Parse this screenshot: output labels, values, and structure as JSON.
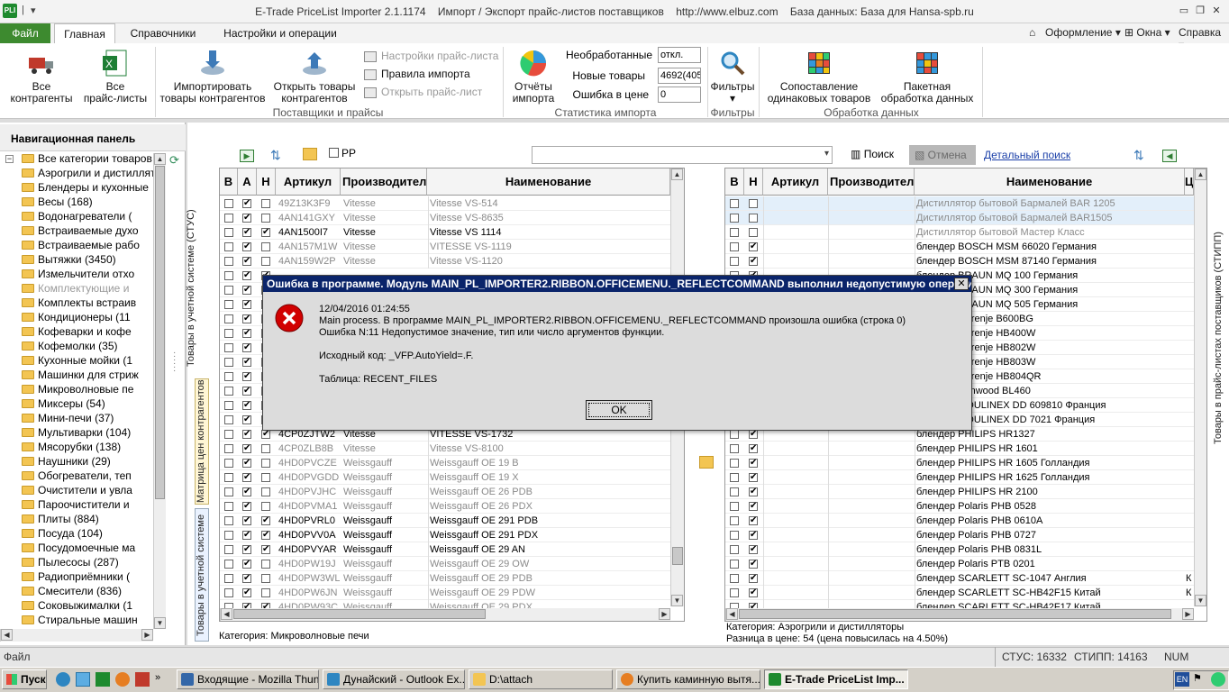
{
  "window": {
    "title": "E-Trade PriceList Importer 2.1.1174    Импорт / Экспорт прайс-листов поставщиков    http://www.elbuz.com    База данных: База для Hansa-spb.ru",
    "app_icon": "PLI"
  },
  "menu": {
    "file": "Файл",
    "tabs": [
      "Главная",
      "Справочники",
      "Настройки и операции"
    ],
    "right": [
      "Оформление",
      "Окна",
      "Справка"
    ]
  },
  "ribbon": {
    "contractors": "Все\nконтрагенты",
    "pricelists": "Все\nпрайс-листы",
    "import_goods": "Импортировать\nтовары контрагентов",
    "open_goods": "Открыть товары\nконтрагентов",
    "pricelist_settings": "Настройки прайс-листа",
    "import_rules": "Правила импорта",
    "open_pricelist": "Открыть прайс-лист",
    "group_suppliers": "Поставщики и прайсы",
    "import_reports": "Отчёты\nимпорта",
    "stat_unprocessed_label": "Необработанные",
    "stat_unprocessed_value": "откл.",
    "stat_new_label": "Новые товары",
    "stat_new_value": "4692(405",
    "stat_error_label": "Ошибка в цене",
    "stat_error_value": "0",
    "group_stats": "Статистика импорта",
    "filters": "Фильтры",
    "group_filters": "Фильтры",
    "match_goods": "Сопоставление\nодинаковых товаров",
    "batch_processing": "Пакетная\nобработка данных",
    "group_data": "Обработка данных"
  },
  "nav": {
    "title": "Навигационная панель",
    "root": "Все категории товаров",
    "items": [
      {
        "label": "Аэрогрили и дистиллят",
        "disabled": false
      },
      {
        "label": "Блендеры и кухонные",
        "disabled": false
      },
      {
        "label": "Весы (168)",
        "disabled": false
      },
      {
        "label": "Водонагреватели (",
        "disabled": false
      },
      {
        "label": "Встраиваемые духо",
        "disabled": false
      },
      {
        "label": "Встраиваемые рабо",
        "disabled": false
      },
      {
        "label": "Вытяжки (3450)",
        "disabled": false
      },
      {
        "label": "Измельчители отхо",
        "disabled": false
      },
      {
        "label": "Комплектующие и",
        "disabled": true
      },
      {
        "label": "Комплекты встраив",
        "disabled": false
      },
      {
        "label": "Кондиционеры (11",
        "disabled": false
      },
      {
        "label": "Кофеварки и кофе",
        "disabled": false
      },
      {
        "label": "Кофемолки (35)",
        "disabled": false
      },
      {
        "label": "Кухонные мойки (1",
        "disabled": false
      },
      {
        "label": "Машинки для стриж",
        "disabled": false
      },
      {
        "label": "Микроволновые пе",
        "disabled": false
      },
      {
        "label": "Миксеры (54)",
        "disabled": false
      },
      {
        "label": "Мини-печи (37)",
        "disabled": false
      },
      {
        "label": "Мультиварки (104)",
        "disabled": false
      },
      {
        "label": "Мясорубки (138)",
        "disabled": false
      },
      {
        "label": "Наушники (29)",
        "disabled": false
      },
      {
        "label": "Обогреватели, теп",
        "disabled": false
      },
      {
        "label": "Очистители и увла",
        "disabled": false
      },
      {
        "label": "Пароочистители и",
        "disabled": false
      },
      {
        "label": "Плиты (884)",
        "disabled": false
      },
      {
        "label": "Посуда (104)",
        "disabled": false
      },
      {
        "label": "Посудомоечные ма",
        "disabled": false
      },
      {
        "label": "Пылесосы (287)",
        "disabled": false
      },
      {
        "label": "Радиоприёмники (",
        "disabled": false
      },
      {
        "label": "Смесители (836)",
        "disabled": false
      },
      {
        "label": "Соковыжималки (1",
        "disabled": false
      },
      {
        "label": "Стиральные машин",
        "disabled": false
      }
    ]
  },
  "left_panel": {
    "side_tab_top": "Товары в учетной системе (СТУС)",
    "side_tab_matrix": "Матрица цен контрагентов",
    "side_tab_bottom": "Товары в учетной системе",
    "pp_label": "PP",
    "headers": [
      "В",
      "А",
      "Н",
      "Артикул",
      "Производитель",
      "Наименование"
    ],
    "rows": [
      {
        "a": true,
        "n": false,
        "art": "49Z13K3F9",
        "mfr": "Vitesse",
        "name": "Vitesse VS-514",
        "gray": true
      },
      {
        "a": true,
        "n": false,
        "art": "4AN141GXY",
        "mfr": "Vitesse",
        "name": "Vitesse VS-8635",
        "gray": true
      },
      {
        "a": true,
        "n": true,
        "art": "4AN1500I7",
        "mfr": "Vitesse",
        "name": "Vitesse VS 1114",
        "gray": false
      },
      {
        "a": true,
        "n": false,
        "art": "4AN157M1W",
        "mfr": "Vitesse",
        "name": "VITESSE VS-1119",
        "gray": true
      },
      {
        "a": true,
        "n": false,
        "art": "4AN159W2P",
        "mfr": "Vitesse",
        "name": "Vitesse VS-1120",
        "gray": true
      },
      {
        "a": true,
        "n": true,
        "art": "",
        "mfr": "",
        "name": "",
        "gray": false
      },
      {
        "a": true,
        "n": true,
        "art": "",
        "mfr": "",
        "name": "",
        "gray": false
      },
      {
        "a": true,
        "n": true,
        "art": "",
        "mfr": "",
        "name": "",
        "gray": false
      },
      {
        "a": true,
        "n": true,
        "art": "",
        "mfr": "",
        "name": "",
        "gray": false
      },
      {
        "a": true,
        "n": true,
        "art": "",
        "mfr": "",
        "name": "",
        "gray": false
      },
      {
        "a": true,
        "n": true,
        "art": "",
        "mfr": "",
        "name": "",
        "gray": false
      },
      {
        "a": true,
        "n": true,
        "art": "",
        "mfr": "",
        "name": "",
        "gray": false
      },
      {
        "a": true,
        "n": true,
        "art": "",
        "mfr": "",
        "name": "",
        "gray": false
      },
      {
        "a": true,
        "n": true,
        "art": "",
        "mfr": "",
        "name": "",
        "gray": false
      },
      {
        "a": true,
        "n": true,
        "art": "",
        "mfr": "",
        "name": "",
        "gray": false
      },
      {
        "a": true,
        "n": true,
        "art": "",
        "mfr": "",
        "name": "",
        "gray": false
      },
      {
        "a": true,
        "n": true,
        "art": "4CP0ZJTW2",
        "mfr": "Vitesse",
        "name": "VITESSE VS-1732",
        "gray": false
      },
      {
        "a": true,
        "n": false,
        "art": "4CP0ZLB8B",
        "mfr": "Vitesse",
        "name": "Vitesse VS-8100",
        "gray": true
      },
      {
        "a": true,
        "n": false,
        "art": "4HD0PVCZE",
        "mfr": "Weissgauff",
        "name": "Weissgauff OE 19 B",
        "gray": true
      },
      {
        "a": true,
        "n": false,
        "art": "4HD0PVGDD",
        "mfr": "Weissgauff",
        "name": "Weissgauff OE 19 X",
        "gray": true
      },
      {
        "a": true,
        "n": false,
        "art": "4HD0PVJHC",
        "mfr": "Weissgauff",
        "name": "Weissgauff OE 26 PDB",
        "gray": true
      },
      {
        "a": true,
        "n": false,
        "art": "4HD0PVMA1",
        "mfr": "Weissgauff",
        "name": "Weissgauff OE 26 PDX",
        "gray": true
      },
      {
        "a": true,
        "n": true,
        "art": "4HD0PVRL0",
        "mfr": "Weissgauff",
        "name": "Weissgauff OE 291 PDB",
        "gray": false
      },
      {
        "a": true,
        "n": true,
        "art": "4HD0PVV0A",
        "mfr": "Weissgauff",
        "name": "Weissgauff OE 291 PDX",
        "gray": false
      },
      {
        "a": true,
        "n": true,
        "art": "4HD0PVYAR",
        "mfr": "Weissgauff",
        "name": "Weissgauff OE 29 AN",
        "gray": false
      },
      {
        "a": true,
        "n": false,
        "art": "4HD0PW19J",
        "mfr": "Weissgauff",
        "name": "Weissgauff OE 29 OW",
        "gray": true
      },
      {
        "a": true,
        "n": false,
        "art": "4HD0PW3WL",
        "mfr": "Weissgauff",
        "name": "Weissgauff OE 29 PDB",
        "gray": true
      },
      {
        "a": true,
        "n": false,
        "art": "4HD0PW6JN",
        "mfr": "Weissgauff",
        "name": "Weissgauff OE 29 PDW",
        "gray": true
      },
      {
        "a": true,
        "n": true,
        "art": "4HD0PW93C",
        "mfr": "Weissgauff",
        "name": "Weissgauff OE 29 PDX",
        "gray": true
      }
    ],
    "category": "Категория: Микроволновые печи"
  },
  "right_panel": {
    "search_button": "Поиск",
    "cancel_button": "Отмена",
    "detail_search": "Детальный поиск",
    "side_tab": "Товары в прайс-листах поставщиков (СТИПП)",
    "headers": [
      "В",
      "Н",
      "Артикул",
      "Производитель",
      "Наименование",
      "Ц"
    ],
    "rows": [
      {
        "n": false,
        "name": "Дистиллятор бытовой Бармалей BAR 1205",
        "gray": true,
        "sel": true
      },
      {
        "n": false,
        "name": "Дистиллятор бытовой Бармалей BAR1505",
        "gray": true,
        "sel": true
      },
      {
        "n": false,
        "name": "Дистиллятор бытовой Мастер Класс",
        "gray": true,
        "sel": false
      },
      {
        "n": true,
        "name": "блендер BOSCH  MSM 66020 Германия",
        "gray": false,
        "sel": false
      },
      {
        "n": true,
        "name": "блендер BOSCH  MSM 87140 Германия",
        "gray": false,
        "sel": false
      },
      {
        "n": true,
        "name": "блендер BRAUN  MQ 100 Германия",
        "gray": false,
        "sel": false
      },
      {
        "n": true,
        "name": "блендер BRAUN  MQ 300 Германия",
        "gray": false,
        "sel": false
      },
      {
        "n": true,
        "name": "блендер BRAUN  MQ 505 Германия",
        "gray": false,
        "sel": false
      },
      {
        "n": true,
        "name": "блендер Gorenje B600BG",
        "gray": false,
        "sel": false
      },
      {
        "n": true,
        "name": "блендер Gorenje HB400W",
        "gray": false,
        "sel": false
      },
      {
        "n": true,
        "name": "блендер Gorenje HB802W",
        "gray": false,
        "sel": false
      },
      {
        "n": true,
        "name": "блендер Gorenje HB803W",
        "gray": false,
        "sel": false
      },
      {
        "n": true,
        "name": "блендер Gorenje HB804QR",
        "gray": false,
        "sel": false
      },
      {
        "n": true,
        "name": "блендер Kenwood BL460",
        "gray": false,
        "sel": false
      },
      {
        "n": true,
        "name": "блендер MOULINEX DD 609810 Франция",
        "gray": false,
        "sel": false
      },
      {
        "n": true,
        "name": "блендер MOULINEX DD 7021 Франция",
        "gray": false,
        "sel": false
      },
      {
        "n": true,
        "name": "блендер  PHILIPS  HR1327",
        "gray": false,
        "sel": false
      },
      {
        "n": true,
        "name": "блендер PHILIPS HR 1601",
        "gray": false,
        "sel": false
      },
      {
        "n": true,
        "name": "блендер PHILIPS HR 1605 Голландия",
        "gray": false,
        "sel": false
      },
      {
        "n": true,
        "name": "блендер PHILIPS HR 1625 Голландия",
        "gray": false,
        "sel": false
      },
      {
        "n": true,
        "name": "блендер PHILIPS HR 2100",
        "gray": false,
        "sel": false
      },
      {
        "n": true,
        "name": "блендер Polaris PHB 0528",
        "gray": false,
        "sel": false
      },
      {
        "n": true,
        "name": "блендер Polaris PHB 0610A",
        "gray": false,
        "sel": false
      },
      {
        "n": true,
        "name": "блендер Polaris PHB 0727",
        "gray": false,
        "sel": false
      },
      {
        "n": true,
        "name": "блендер Polaris PHB 0831L",
        "gray": false,
        "sel": false
      },
      {
        "n": true,
        "name": "блендер Polaris PTB 0201",
        "gray": false,
        "sel": false
      },
      {
        "n": true,
        "name": "блендер SCARLETT SC-1047 Англия",
        "gray": false,
        "sel": false,
        "extra": "К"
      },
      {
        "n": true,
        "name": "блендер SCARLETT SC-HB42F15 Китай",
        "gray": false,
        "sel": false,
        "extra": "К"
      },
      {
        "n": true,
        "name": "блендер SCARLETT SC-HB42F17 Китай",
        "gray": false,
        "sel": false
      }
    ],
    "category": "Категория: Аэрогрили и дистилляторы",
    "price_diff": "Разница в цене: 54  (цена повысилась на 4.50%)"
  },
  "dialog": {
    "title": "Ошибка в программе. Модуль MAIN_PL_IMPORTER2.RIBBON.OFFICEMENU._REFLECTCOMMAND выполнил недопустимую операцию.",
    "datetime": "12/04/2016 01:24:55",
    "line1": "Main process. В программе MAIN_PL_IMPORTER2.RIBBON.OFFICEMENU._REFLECTCOMMAND произошла ошибка (строка 0)",
    "line2": "Ошибка N:11 Недопустимое значение, тип или число аргументов функции.",
    "source": "Исходный код:  _VFP.AutoYield=.F.",
    "table": "Таблица: RECENT_FILES",
    "ok": "OK"
  },
  "statusbar": {
    "left": "Файл",
    "stus": "СТУС: 16332",
    "stipp": "СТИПП: 14163",
    "num": "NUM"
  },
  "taskbar": {
    "start": "Пуск",
    "tasks": [
      "Входящие - Mozilla Thun...",
      "Дунайский - Outlook Ex...",
      "D:\\attach",
      "Купить каминную вытя...",
      "E-Trade PriceList Imp..."
    ],
    "lang": "EN"
  }
}
